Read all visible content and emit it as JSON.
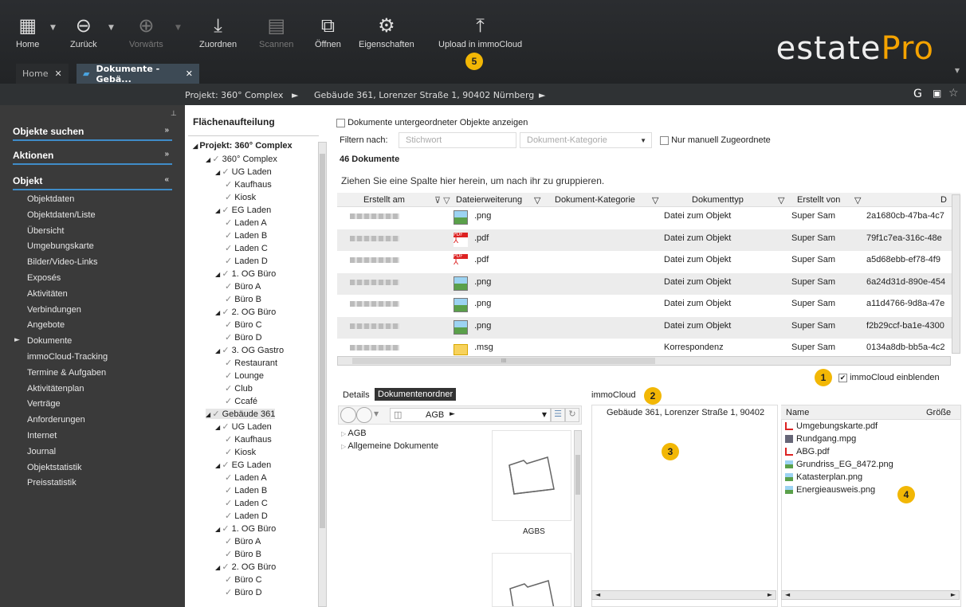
{
  "ribbon": {
    "home": "Home",
    "back": "Zurück",
    "forward": "Vorwärts",
    "assign": "Zuordnen",
    "scan": "Scannen",
    "open": "Öffnen",
    "properties": "Eigenschaften",
    "upload": "Upload in immoCloud"
  },
  "logo": {
    "part1": "estate",
    "part2": "Pro"
  },
  "tabs": {
    "home": "Home",
    "docs": "Dokumente - Gebä..."
  },
  "breadcrumb": {
    "project": "Projekt: 360° Complex",
    "building": "Gebäude 361, Lorenzer Straße 1, 90402 Nürnberg"
  },
  "sidebar": {
    "search": "Objekte suchen",
    "actions": "Aktionen",
    "object": "Objekt",
    "items": [
      "Objektdaten",
      "Objektdaten/Liste",
      "Übersicht",
      "Umgebungskarte",
      "Bilder/Video-Links",
      "Exposés",
      "Aktivitäten",
      "Verbindungen",
      "Angebote",
      "Dokumente",
      "immoCloud-Tracking",
      "Termine & Aufgaben",
      "Aktivitätenplan",
      "Verträge",
      "Anforderungen",
      "Internet",
      "Journal",
      "Objektstatistik",
      "Preisstatistik"
    ]
  },
  "tree": {
    "title": "Flächenaufteilung",
    "nodes": [
      "Projekt: 360° Complex",
      "360° Complex",
      "UG Laden",
      "Kaufhaus",
      "Kiosk",
      "EG Laden",
      "Laden A",
      "Laden B",
      "Laden C",
      "Laden D",
      "1. OG Büro",
      "Büro A",
      "Büro B",
      "2. OG Büro",
      "Büro C",
      "Büro D",
      "3. OG Gastro",
      "Restaurant",
      "Lounge",
      "Club",
      "Ccafé",
      "Gebäude 361",
      "UG Laden",
      "Kaufhaus",
      "Kiosk",
      "EG Laden",
      "Laden A",
      "Laden B",
      "Laden C",
      "Laden D",
      "1. OG Büro",
      "Büro A",
      "Büro B",
      "2. OG Büro",
      "Büro C",
      "Büro D"
    ]
  },
  "docs": {
    "show_sub": "Dokumente untergeordneter Objekte anzeigen",
    "filter_label": "Filtern nach:",
    "keyword_ph": "Stichwort",
    "category_ph": "Dokument-Kategorie",
    "manual_only": "Nur manuell Zugeordnete",
    "count": "46 Dokumente",
    "group_hint": "Ziehen Sie eine Spalte hier herein, um nach ihr zu gruppieren.",
    "columns": [
      "Erstellt am",
      "Dateierweiterung",
      "Dokument-Kategorie",
      "Dokumenttyp",
      "Erstellt von",
      "D"
    ],
    "rows": [
      {
        "ext": ".png",
        "type": "Datei zum Objekt",
        "by": "Super Sam",
        "id": "2a1680cb-47ba-4c7"
      },
      {
        "ext": ".pdf",
        "type": "Datei zum Objekt",
        "by": "Super Sam",
        "id": "79f1c7ea-316c-48e"
      },
      {
        "ext": ".pdf",
        "type": "Datei zum Objekt",
        "by": "Super Sam",
        "id": "a5d68ebb-ef78-4f9"
      },
      {
        "ext": ".png",
        "type": "Datei zum Objekt",
        "by": "Super Sam",
        "id": "6a24d31d-890e-454"
      },
      {
        "ext": ".png",
        "type": "Datei zum Objekt",
        "by": "Super Sam",
        "id": "a11d4766-9d8a-47e"
      },
      {
        "ext": ".png",
        "type": "Datei zum Objekt",
        "by": "Super Sam",
        "id": "f2b29ccf-ba1e-4300"
      },
      {
        "ext": ".msg",
        "type": "Korrespondenz",
        "by": "Super Sam",
        "id": "0134a8db-bb5a-4c2"
      }
    ],
    "scroll_dots": "III",
    "show_cloud": "immoCloud einblenden"
  },
  "lower": {
    "tab_details": "Details",
    "tab_folder": "Dokumentenordner",
    "path": "AGB",
    "folders": [
      "AGB",
      "Allgemeine Dokumente"
    ],
    "folder_label": "AGBS",
    "cloud_title": "immoCloud",
    "cloud_node": "Gebäude 361, Lorenzer Straße 1, 90402",
    "col_name": "Name",
    "col_size": "Größe",
    "files": [
      "Umgebungskarte.pdf",
      "Rundgang.mpg",
      "ABG.pdf",
      "Grundriss_EG_8472.png",
      "Katasterplan.png",
      "Energieausweis.png"
    ]
  },
  "badges": [
    "1",
    "2",
    "3",
    "4",
    "5"
  ]
}
